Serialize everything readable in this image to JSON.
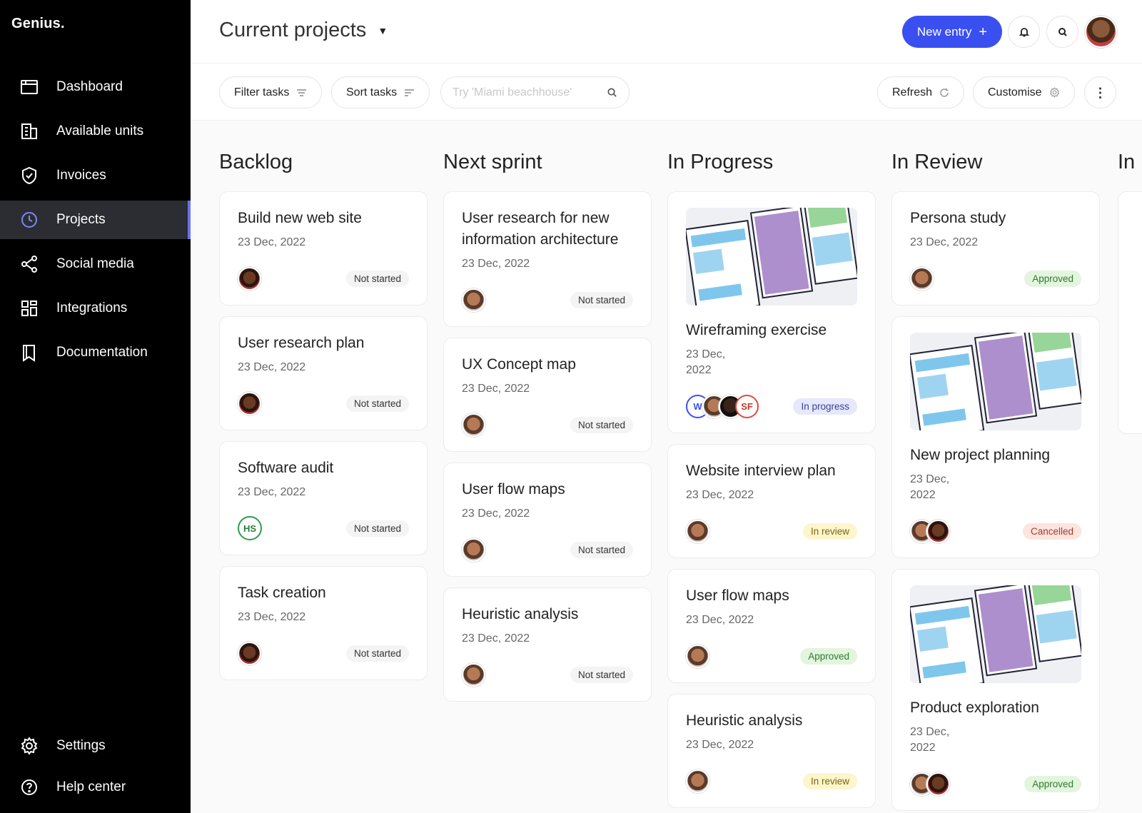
{
  "app": {
    "logo": "Genius."
  },
  "sidebar": {
    "items": [
      {
        "label": "Dashboard",
        "icon": "dashboard-icon"
      },
      {
        "label": "Available units",
        "icon": "building-icon"
      },
      {
        "label": "Invoices",
        "icon": "shield-icon"
      },
      {
        "label": "Projects",
        "icon": "clock-icon",
        "active": true
      },
      {
        "label": "Social media",
        "icon": "share-icon"
      },
      {
        "label": "Integrations",
        "icon": "grid-icon"
      },
      {
        "label": "Documentation",
        "icon": "book-icon"
      }
    ],
    "bottom": [
      {
        "label": "Settings",
        "icon": "gear-icon"
      },
      {
        "label": "Help center",
        "icon": "help-icon"
      }
    ]
  },
  "header": {
    "title": "Current projects",
    "new_entry": "New entry",
    "colors": {
      "accent": "#3a4ff0"
    }
  },
  "toolbar": {
    "filter": "Filter tasks",
    "sort": "Sort tasks",
    "search_placeholder": "Try 'Miami beachhouse'",
    "refresh": "Refresh",
    "customise": "Customise"
  },
  "columns": [
    {
      "title": "Backlog",
      "cards": [
        {
          "title": "Build new web site",
          "date": "23 Dec, 2022",
          "status": "Not started"
        },
        {
          "title": "User research plan",
          "date": "23 Dec, 2022",
          "status": "Not started"
        },
        {
          "title": "Software audit",
          "date": "23 Dec, 2022",
          "status": "Not started",
          "initials": "HS"
        },
        {
          "title": "Task creation",
          "date": "23 Dec, 2022",
          "status": "Not started"
        }
      ]
    },
    {
      "title": "Next sprint",
      "cards": [
        {
          "title": "User research for new information architecture",
          "date": "23 Dec, 2022",
          "status": "Not started"
        },
        {
          "title": "UX Concept map",
          "date": "23 Dec, 2022",
          "status": "Not started"
        },
        {
          "title": "User flow maps",
          "date": "23 Dec, 2022",
          "status": "Not started"
        },
        {
          "title": "Heuristic analysis",
          "date": "23 Dec, 2022",
          "status": "Not started"
        }
      ]
    },
    {
      "title": "In Progress",
      "cards": [
        {
          "title": "Wireframing exercise",
          "date": "23 Dec, 2022",
          "status": "In progress",
          "initials": [
            "W",
            "SF"
          ]
        },
        {
          "title": "Website interview plan",
          "date": "23 Dec, 2022",
          "status": "In review"
        },
        {
          "title": "User flow maps",
          "date": "23 Dec, 2022",
          "status": "Approved"
        },
        {
          "title": "Heuristic analysis",
          "date": "23 Dec, 2022",
          "status": "In review"
        }
      ]
    },
    {
      "title": "In Review",
      "cards": [
        {
          "title": "Persona study",
          "date": "23 Dec, 2022",
          "status": "Approved"
        },
        {
          "title": "New project planning",
          "date": "23 Dec, 2022",
          "status": "Cancelled"
        },
        {
          "title": "Product exploration",
          "date": "23 Dec, 2022",
          "status": "Approved"
        }
      ]
    },
    {
      "title": "In"
    }
  ]
}
